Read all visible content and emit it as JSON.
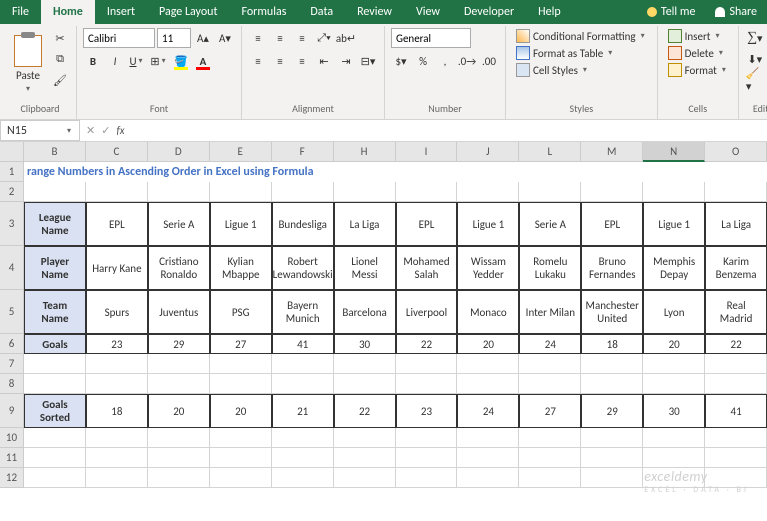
{
  "tabs": [
    "File",
    "Home",
    "Insert",
    "Page Layout",
    "Formulas",
    "Data",
    "Review",
    "View",
    "Developer",
    "Help"
  ],
  "active_tab": "Home",
  "tellme": "Tell me",
  "share": "Share",
  "ribbon": {
    "clipboard": {
      "paste": "Paste",
      "label": "Clipboard"
    },
    "font": {
      "name": "Calibri",
      "size": "11",
      "label": "Font"
    },
    "alignment": {
      "label": "Alignment"
    },
    "number": {
      "format": "General",
      "label": "Number"
    },
    "styles": {
      "cf": "Conditional Formatting",
      "ft": "Format as Table",
      "cs": "Cell Styles",
      "label": "Styles"
    },
    "cells": {
      "insert": "Insert",
      "delete": "Delete",
      "format": "Format",
      "label": "Cells"
    },
    "editing": {
      "label": "Editing"
    }
  },
  "namebox": "N15",
  "formula": "",
  "columns": [
    "B",
    "C",
    "D",
    "E",
    "F",
    "H",
    "I",
    "J",
    "L",
    "M",
    "N",
    "O"
  ],
  "selected_col": "N",
  "title_text": "range Numbers in Ascending Order in Excel using Formula",
  "row_labels": {
    "league": "League Name",
    "player": "Player Name",
    "team": "Team Name",
    "goals": "Goals",
    "sorted": "Goals Sorted"
  },
  "leagues": [
    "EPL",
    "Serie A",
    "Ligue 1",
    "Bundesliga",
    "La Liga",
    "EPL",
    "Ligue 1",
    "Serie A",
    "EPL",
    "Ligue 1",
    "La Liga"
  ],
  "players": [
    "Harry Kane",
    "Cristiano Ronaldo",
    "Kylian Mbappe",
    "Robert Lewandowski",
    "Lionel Messi",
    "Mohamed Salah",
    "Wissam Yedder",
    "Romelu Lukaku",
    "Bruno Fernandes",
    "Memphis Depay",
    "Karim Benzema"
  ],
  "teams": [
    "Spurs",
    "Juventus",
    "PSG",
    "Bayern Munich",
    "Barcelona",
    "Liverpool",
    "Monaco",
    "Inter Milan",
    "Manchester United",
    "Lyon",
    "Real Madrid"
  ],
  "goals": [
    "23",
    "29",
    "27",
    "41",
    "30",
    "22",
    "20",
    "24",
    "18",
    "20",
    "22"
  ],
  "sorted": [
    "18",
    "20",
    "20",
    "21",
    "22",
    "23",
    "24",
    "27",
    "29",
    "30",
    "41"
  ],
  "row_nums": [
    "1",
    "2",
    "3",
    "4",
    "5",
    "6",
    "7",
    "8",
    "9",
    "10",
    "11",
    "12"
  ],
  "chart_data": {
    "type": "table",
    "title": "range Numbers in Ascending Order in Excel using Formula",
    "rows": [
      {
        "label": "League Name",
        "values": [
          "EPL",
          "Serie A",
          "Ligue 1",
          "Bundesliga",
          "La Liga",
          "EPL",
          "Ligue 1",
          "Serie A",
          "EPL",
          "Ligue 1",
          "La Liga"
        ]
      },
      {
        "label": "Player Name",
        "values": [
          "Harry Kane",
          "Cristiano Ronaldo",
          "Kylian Mbappe",
          "Robert Lewandowski",
          "Lionel Messi",
          "Mohamed Salah",
          "Wissam Yedder",
          "Romelu Lukaku",
          "Bruno Fernandes",
          "Memphis Depay",
          "Karim Benzema"
        ]
      },
      {
        "label": "Team Name",
        "values": [
          "Spurs",
          "Juventus",
          "PSG",
          "Bayern Munich",
          "Barcelona",
          "Liverpool",
          "Monaco",
          "Inter Milan",
          "Manchester United",
          "Lyon",
          "Real Madrid"
        ]
      },
      {
        "label": "Goals",
        "values": [
          23,
          29,
          27,
          41,
          30,
          22,
          20,
          24,
          18,
          20,
          22
        ]
      },
      {
        "label": "Goals Sorted",
        "values": [
          18,
          20,
          20,
          21,
          22,
          23,
          24,
          27,
          29,
          30,
          41
        ]
      }
    ]
  },
  "watermark": {
    "main": "exceldemy",
    "sub": "EXCEL · DATA · BI"
  }
}
